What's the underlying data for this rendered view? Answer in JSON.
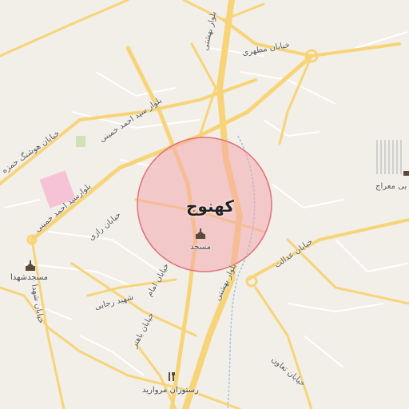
{
  "map": {
    "city": "کهنوج",
    "colors": {
      "background": "#f2efe9",
      "major_road": "#f7d478",
      "major_road_casing": "#e6b94b",
      "minor_road": "#ffffff",
      "highlight_fill": "#f4a7ae",
      "highlight_stroke": "#e0707a",
      "water": "#9fc3e6",
      "park": "#cfe2b5",
      "poi_pink": "#f5c2d6"
    },
    "roads": {
      "motahari": "خیابان مطهری",
      "beheshti_north": "بلوار بهشتی",
      "beheshti_south": "بلوار بهشتی",
      "khomeini": "بلوار سید احمد خمینی",
      "khomeini_2": "بلوارسید احمد خمینی",
      "houshang": "خیابان هوشنگ حمزه",
      "razi": "خیابان رازی",
      "emam": "خیابان امام",
      "shahid_rajai": "شهید رجایی",
      "bahonar": "خیابان باهنر",
      "edalat": "خیابان عدالت",
      "taavon": "خیابان تعاون",
      "shohada_street": "خیابان شهدا",
      "meraj_partial": "بی معراج"
    },
    "pois": [
      {
        "name": "مسجد",
        "icon": "mosque-icon"
      },
      {
        "name": "مسجدشهدا",
        "icon": "mosque-icon"
      },
      {
        "name": "رستوران مروارید",
        "icon": "restaurant-icon"
      }
    ]
  }
}
